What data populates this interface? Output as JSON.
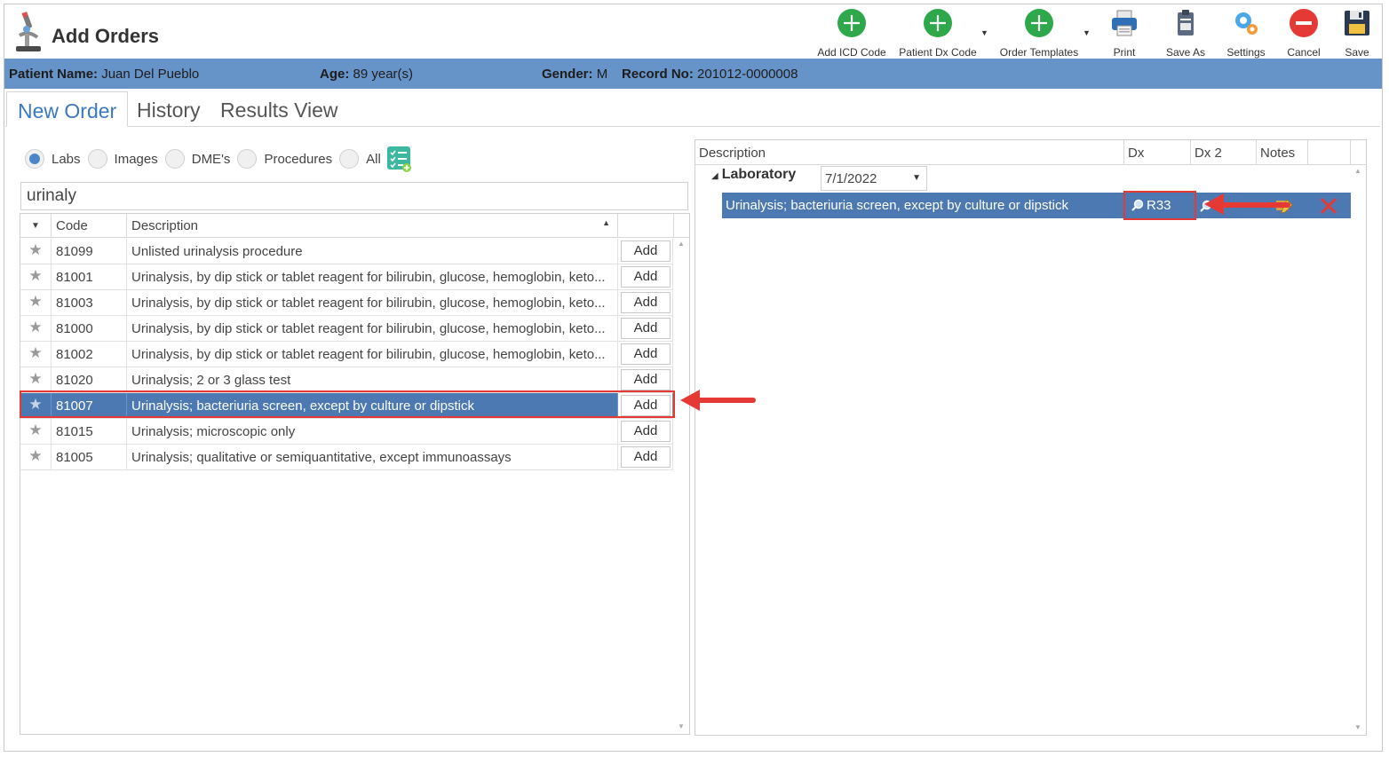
{
  "app": {
    "title": "Add Orders"
  },
  "toolbar": {
    "add_icd": "Add ICD Code",
    "patient_dx": "Patient Dx Code",
    "order_templates": "Order Templates",
    "print": "Print",
    "save_as": "Save As",
    "settings": "Settings",
    "cancel": "Cancel",
    "save": "Save"
  },
  "patient": {
    "name_label": "Patient Name:",
    "name": "Juan Del Pueblo",
    "age_label": "Age:",
    "age": "89 year(s)",
    "gender_label": "Gender:",
    "gender": "M",
    "record_label": "Record No:",
    "record": "201012-0000008"
  },
  "tabs": [
    "New Order",
    "History",
    "Results View"
  ],
  "filters": {
    "options": [
      "Labs",
      "Images",
      "DME's",
      "Procedures",
      "All"
    ],
    "selected": "Labs"
  },
  "search": {
    "value": "urinaly"
  },
  "left_grid": {
    "headers": {
      "code": "Code",
      "description": "Description"
    },
    "add_label": "Add",
    "selected_code": "81007",
    "rows": [
      {
        "code": "81099",
        "description": "Unlisted urinalysis procedure"
      },
      {
        "code": "81001",
        "description": "Urinalysis, by dip stick or tablet reagent for bilirubin, glucose, hemoglobin, keto..."
      },
      {
        "code": "81003",
        "description": "Urinalysis, by dip stick or tablet reagent for bilirubin, glucose, hemoglobin, keto..."
      },
      {
        "code": "81000",
        "description": "Urinalysis, by dip stick or tablet reagent for bilirubin, glucose, hemoglobin, keto..."
      },
      {
        "code": "81002",
        "description": "Urinalysis, by dip stick or tablet reagent for bilirubin, glucose, hemoglobin, keto..."
      },
      {
        "code": "81020",
        "description": "Urinalysis; 2 or 3 glass test"
      },
      {
        "code": "81007",
        "description": "Urinalysis; bacteriuria screen, except by culture or dipstick"
      },
      {
        "code": "81015",
        "description": "Urinalysis; microscopic only"
      },
      {
        "code": "81005",
        "description": "Urinalysis; qualitative or semiquantitative, except immunoassays"
      }
    ]
  },
  "right_grid": {
    "headers": {
      "description": "Description",
      "dx": "Dx",
      "dx2": "Dx 2",
      "notes": "Notes"
    },
    "group": {
      "name": "Laboratory",
      "date": "7/1/2022"
    },
    "order": {
      "description": "Urinalysis; bacteriuria screen, except by culture or dipstick",
      "dx": "R33"
    }
  },
  "colors": {
    "patient_bar": "#6694c8",
    "selection": "#4d79b3",
    "accent_tab": "#3a78c0",
    "annotation": "#e53935",
    "add_green": "#2ea84a",
    "cancel_red": "#e53935"
  }
}
